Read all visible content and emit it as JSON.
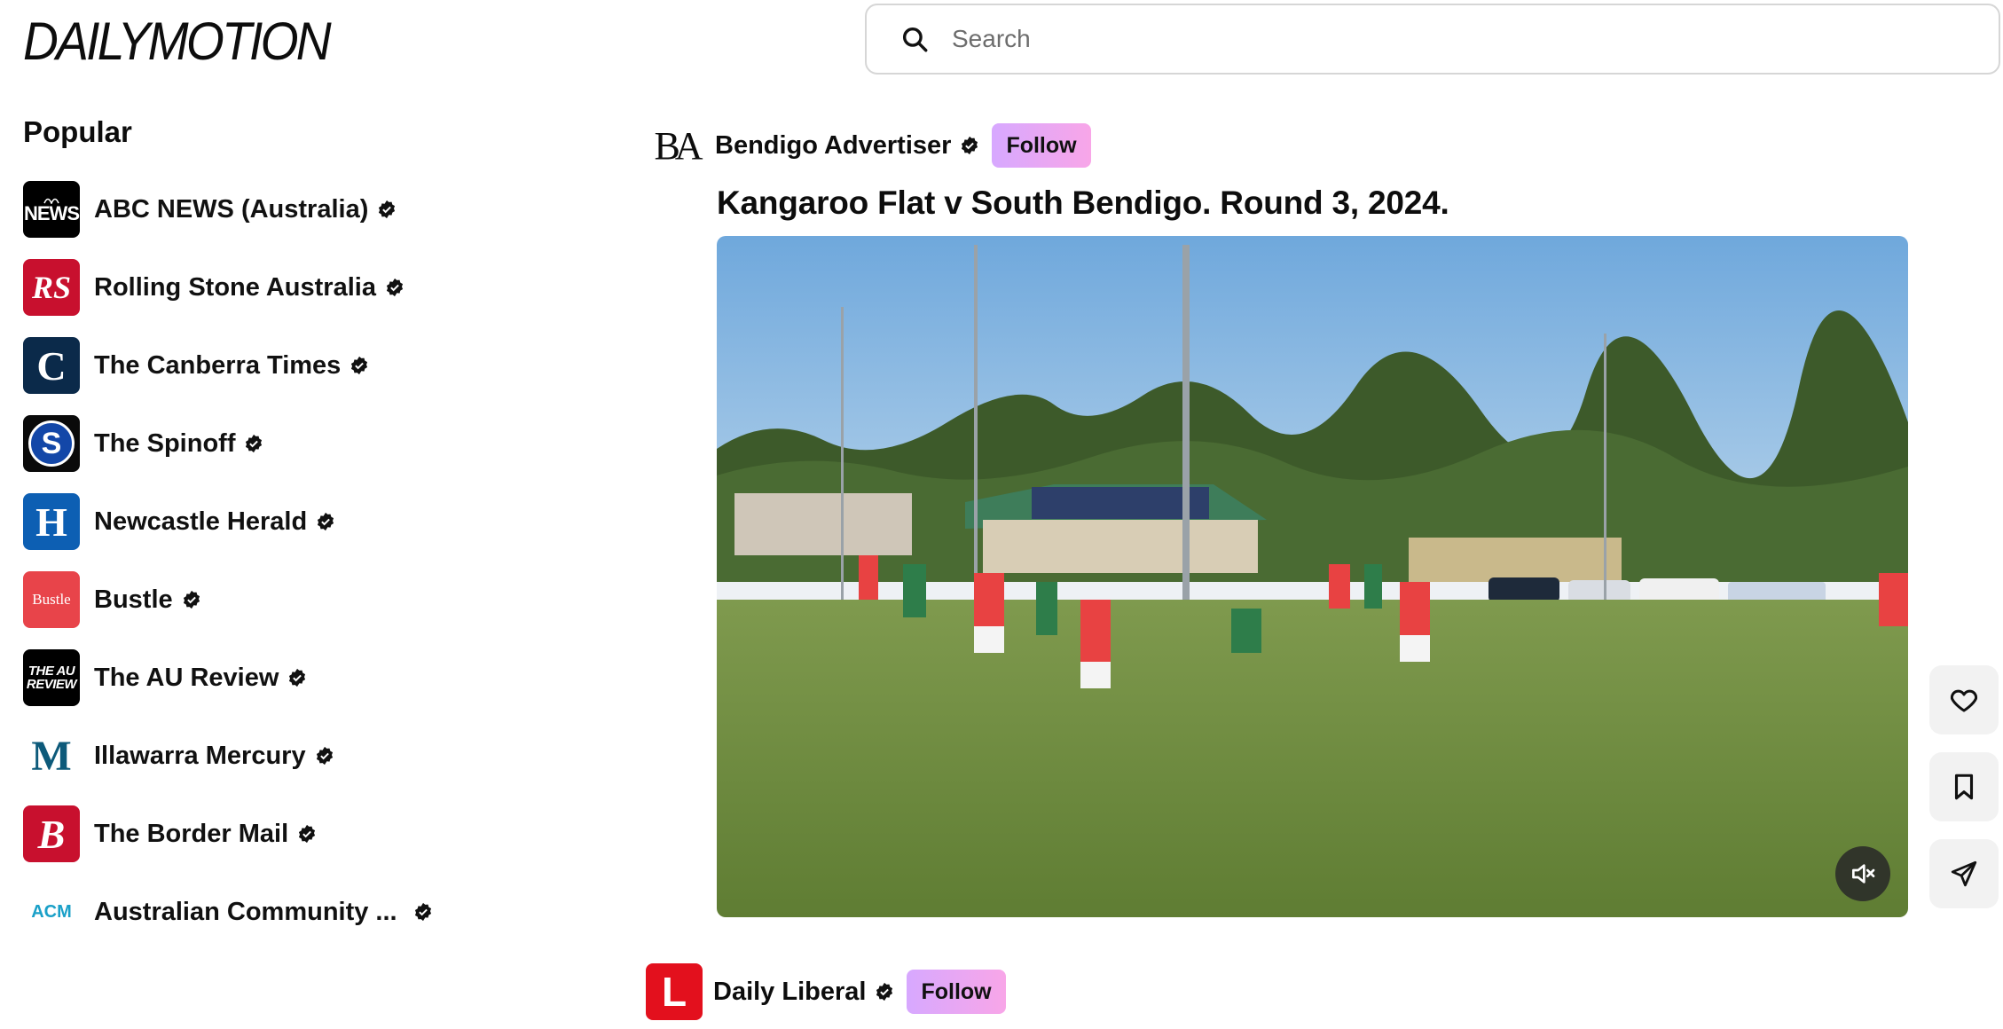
{
  "brand": {
    "logo_text": "DAILYMOTION"
  },
  "search": {
    "placeholder": "Search"
  },
  "sidebar": {
    "title": "Popular",
    "channels": [
      {
        "name": "ABC NEWS (Australia)",
        "logo_text": "NEWS",
        "color": "#000000"
      },
      {
        "name": "Rolling Stone Australia",
        "logo_text": "RS",
        "color": "#c8102e"
      },
      {
        "name": "The Canberra Times",
        "logo_text": "C",
        "color": "#0b2a4a"
      },
      {
        "name": "The Spinoff",
        "logo_text": "S",
        "color": "#0a0a0a"
      },
      {
        "name": "Newcastle Herald",
        "logo_text": "H",
        "color": "#0d5fb3"
      },
      {
        "name": "Bustle",
        "logo_text": "Bustle",
        "color": "#e8444a"
      },
      {
        "name": "The AU Review",
        "logo_text": "THE AU REVIEW",
        "color": "#000000"
      },
      {
        "name": "Illawarra Mercury",
        "logo_text": "M",
        "color": "#ffffff"
      },
      {
        "name": "The Border Mail",
        "logo_text": "B",
        "color": "#c8102e"
      },
      {
        "name": "Australian Community ...",
        "logo_text": "ACM",
        "color": "#ffffff"
      }
    ]
  },
  "feed": {
    "item1": {
      "author": "Bendigo Advertiser",
      "author_logo": "BA",
      "follow_label": "Follow",
      "title": "Kangaroo Flat v South Bendigo. Round 3, 2024."
    },
    "item2": {
      "author": "Daily Liberal",
      "author_logo": "L",
      "follow_label": "Follow"
    }
  },
  "colors": {
    "follow_gradient_start": "#d7a8ff",
    "follow_gradient_end": "#f8a6e8",
    "accent_red": "#c8102e"
  },
  "icons": [
    "search-icon",
    "verified-icon",
    "heart-icon",
    "bookmark-icon",
    "share-icon",
    "mute-icon"
  ]
}
